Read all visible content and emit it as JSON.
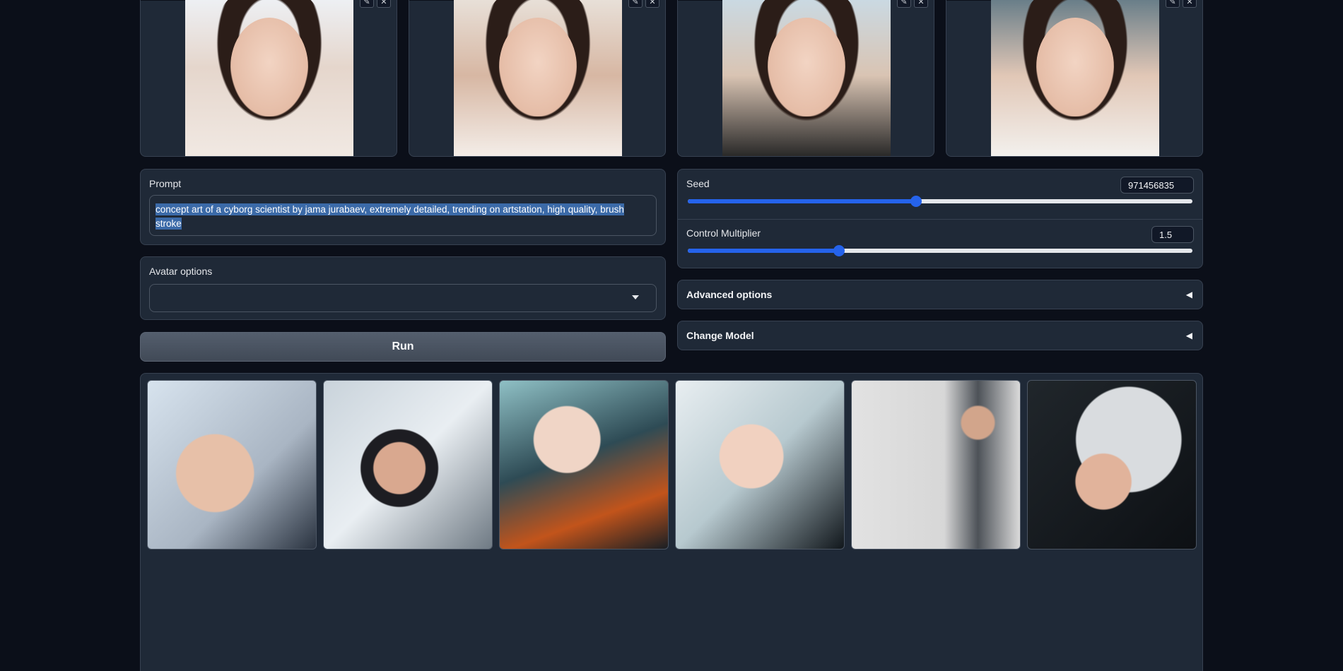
{
  "input_images": [
    {
      "id": "input-image-1"
    },
    {
      "id": "input-image-2"
    },
    {
      "id": "input-image-3"
    },
    {
      "id": "input-image-4"
    }
  ],
  "prompt": {
    "label": "Prompt",
    "value": "concept art of a cyborg scientist by jama jurabaev, extremely detailed, trending on artstation, high quality, brush stroke"
  },
  "avatar": {
    "label": "Avatar options",
    "value": ""
  },
  "run": {
    "label": "Run"
  },
  "seed": {
    "label": "Seed",
    "value": "971456835",
    "fraction": 0.452
  },
  "control_multiplier": {
    "label": "Control Multiplier",
    "value": "1.5",
    "fraction": 0.3
  },
  "advanced": {
    "label": "Advanced options",
    "arrow": "◀"
  },
  "change_model": {
    "label": "Change Model",
    "arrow": "◀"
  },
  "icons": {
    "edit": "✎",
    "close": "✕"
  },
  "colors": {
    "accent": "#2563eb",
    "background": "#0b0f19",
    "panel": "#1f2937"
  }
}
